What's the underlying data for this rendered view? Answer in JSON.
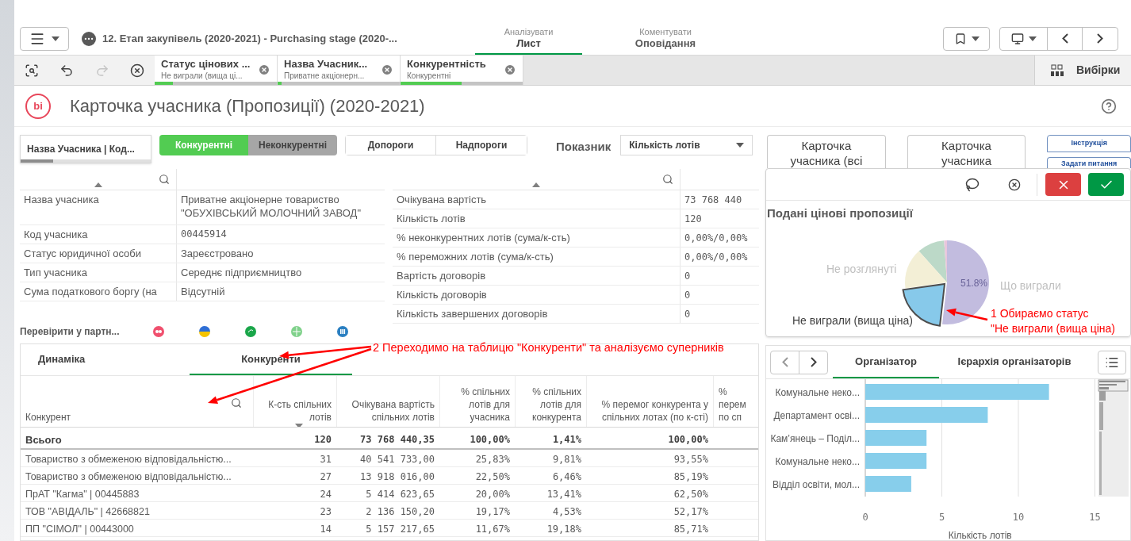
{
  "top_bar": {
    "app_title": "12. Етап закупівель (2020-2021) - Purchasing stage (2020-...",
    "modes": [
      {
        "caption": "Аналізувати",
        "label": "Лист",
        "selected": true
      },
      {
        "caption": "Коментувати",
        "label": "Оповідання",
        "selected": false
      }
    ]
  },
  "selection_bar": {
    "tools": [
      {
        "kind": "zoom",
        "disabled": false
      },
      {
        "kind": "back",
        "disabled": false
      },
      {
        "kind": "forward",
        "disabled": true
      },
      {
        "kind": "clear",
        "disabled": false
      }
    ],
    "chips": [
      {
        "field": "Статус цінових ...",
        "value": "Не виграли (вища ці...",
        "level": 0.15
      },
      {
        "field": "Назва Учасник...",
        "value": "Приватне акціонерн...",
        "level": 0.03
      },
      {
        "field": "Конкурентність",
        "value": "Конкурентні",
        "level": 0.5
      }
    ],
    "selections_label": "Вибірки"
  },
  "sheet": {
    "logo": "bi",
    "title": "Карточка учасника (Пропозиції) (2020-2021)"
  },
  "filters": {
    "field_box": {
      "label": "Назва Учасника | Код...",
      "level": 0.25
    },
    "toggle": [
      {
        "label": "Конкурентні",
        "selected": true
      },
      {
        "label": "Неконкурентні",
        "selected": false
      }
    ],
    "thresholds": [
      {
        "label": "Допороги",
        "selected": false
      },
      {
        "label": "Надпороги",
        "selected": false
      }
    ],
    "measure_label": "Показник",
    "measure_value": "Кількість лотів"
  },
  "participant_table": {
    "rows": [
      {
        "kind": "text",
        "label": "Назва учасника",
        "value": "Приватне акціонерне товариство \"ОБУХІВСЬКИЙ МОЛОЧНИЙ ЗАВОД\""
      },
      {
        "kind": "number",
        "label": "Код учасника",
        "value": "00445914"
      },
      {
        "kind": "text",
        "label": "Статус юридичної особи",
        "value": "Зареєстровано"
      },
      {
        "kind": "text",
        "label": "Тип учасника",
        "value": "Середнє підприємництво"
      },
      {
        "kind": "text",
        "label": "Сума податкового боргу (на",
        "value": "Відсутній"
      }
    ]
  },
  "metrics_table": {
    "rows": [
      {
        "label": "Очікувана вартість",
        "value": "73 768 440"
      },
      {
        "label": "Кількість лотів",
        "value": "120"
      },
      {
        "label": "% неконкурентних лотів (сума/к-сть)",
        "value": "0,00%/0,00%"
      },
      {
        "label": "% переможних лотів (сума/к-сть)",
        "value": "0,00%/0,00%"
      },
      {
        "label": "Вартість договорів",
        "value": "0"
      },
      {
        "label": "Кількість договорів",
        "value": "0"
      },
      {
        "label": "Кількість завершених договорів",
        "value": "0"
      }
    ]
  },
  "partner_check": {
    "label": "Перевірити у партн..."
  },
  "competitors": {
    "tabs": [
      {
        "label": "Динаміка",
        "selected": false
      },
      {
        "label": "Конкуренти",
        "selected": true
      }
    ],
    "columns": [
      "Конкурент",
      "К-сть спільних лотів",
      "Очікувана вартість спільних лотів",
      "% спільних лотів для учасника",
      "% спільних лотів для конкурента",
      "% перемог конкурента у спільних лотах (по к-сті)",
      "% перем по сп"
    ],
    "total": [
      "Всього",
      "120",
      "73 768 440,35",
      "100,00%",
      "1,41%",
      "100,00%"
    ],
    "rows": [
      [
        "Товариство з обмеженою відповідальністю...",
        "31",
        "40 541 733,00",
        "25,83%",
        "9,81%",
        "93,55%"
      ],
      [
        "Товариство з обмеженою відповідальністю...",
        "27",
        "13 918 016,00",
        "22,50%",
        "6,46%",
        "85,19%"
      ],
      [
        "ПрАТ \"Кагма\" | 00445883",
        "24",
        "5 414 623,65",
        "20,00%",
        "13,41%",
        "62,50%"
      ],
      [
        "ТОВ \"АВІДАЛЬ\" | 42668821",
        "23",
        "2 136 150,20",
        "19,17%",
        "4,53%",
        "52,17%"
      ],
      [
        "ПП \"СІМОЛ\" | 00443000",
        "14",
        "5 157 217,65",
        "11,67%",
        "19,18%",
        "85,71%"
      ]
    ]
  },
  "nav_cards": [
    "Карточка учасника (всі",
    "Карточка учасника"
  ],
  "help_buttons": [
    "Інструкція",
    "Задати питання"
  ],
  "pie_panel": {
    "title": "Подані цінові пропозиції",
    "value_label": "51.8%",
    "slices": [
      {
        "label": "Не розглянуті",
        "selected": false
      },
      {
        "label": "Що виграли",
        "selected": false
      },
      {
        "label": "Не виграли (вища ціна)",
        "selected": true
      }
    ]
  },
  "organizer_panel": {
    "tabs": [
      {
        "label": "Організатор",
        "selected": true
      },
      {
        "label": "Ієрархія організаторів",
        "selected": false
      }
    ],
    "chart_data": {
      "type": "bar",
      "orientation": "horizontal",
      "xlabel": "Кількість лотів",
      "categories": [
        "Комунальне неко...",
        "Департамент осві...",
        "Кам’янець – Поділ...",
        "Комунальне неко...",
        "Відділ освіти, мол..."
      ],
      "series": [
        {
          "color": "#87ceeb",
          "values": [
            12,
            8,
            4,
            4,
            3
          ]
        }
      ],
      "xlim": [
        0,
        15
      ],
      "xticks": [
        0,
        5,
        10,
        15
      ]
    }
  },
  "annotations": [
    {
      "text": "1 Обираємо статус\n\"Не виграли (вища ціна)"
    },
    {
      "text": "2 Переходимо на таблицю \"Конкуренти\" та аналізуємо суперників"
    }
  ]
}
